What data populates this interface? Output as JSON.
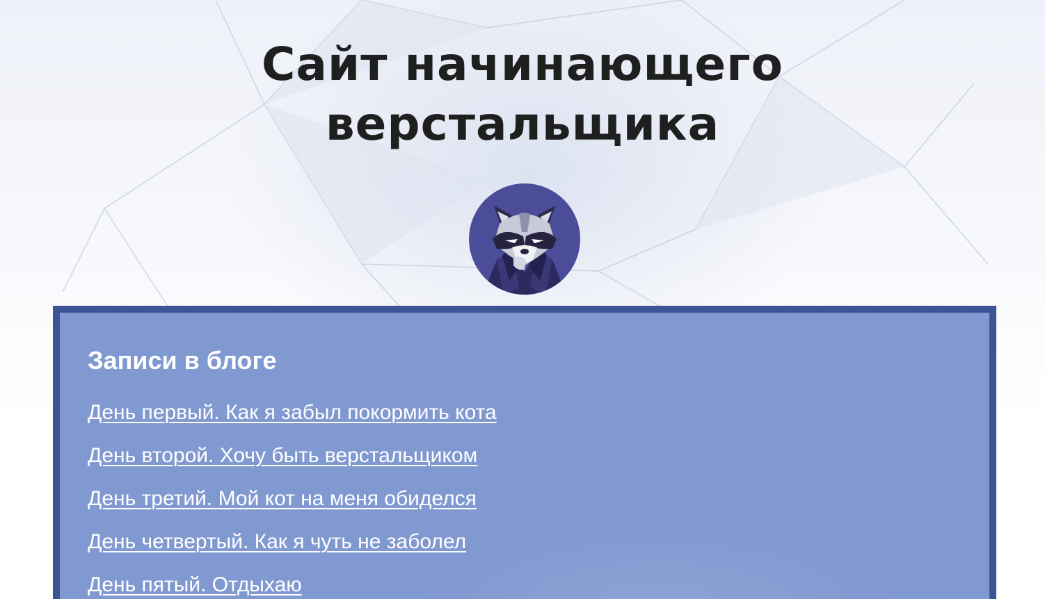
{
  "header": {
    "title_line1": "Сайт начинающего",
    "title_line2": "верстальщика",
    "avatar_icon": "raccoon-avatar-icon"
  },
  "blog": {
    "heading": "Записи в блоге",
    "posts": [
      {
        "label": "День первый. Как я забыл покормить кота"
      },
      {
        "label": "День второй. Хочу быть верстальщиком"
      },
      {
        "label": "День третий. Мой кот на меня обиделся"
      },
      {
        "label": "День четвертый. Как я чуть не заболел"
      },
      {
        "label": "День пятый. Отдыхаю"
      }
    ]
  },
  "colors": {
    "panel_background": "#8199d1",
    "panel_border": "#3d5597",
    "title_text": "#1f1f1f",
    "link_text": "#ffffff",
    "avatar_background": "#4b4d98"
  }
}
